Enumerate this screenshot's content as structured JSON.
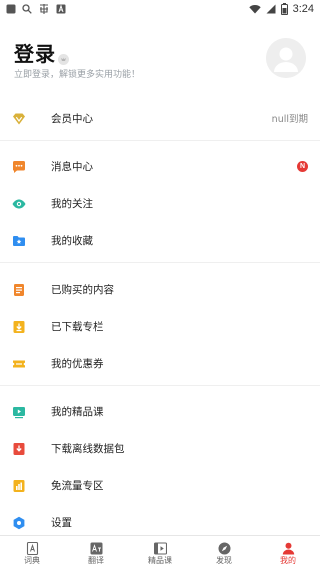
{
  "status_bar": {
    "time": "3:24",
    "left_icons": [
      "app-square-icon",
      "search-icon",
      "chinese-char-icon",
      "font-a-icon"
    ],
    "right_icons": [
      "wifi-icon",
      "signal-icon",
      "battery-icon"
    ]
  },
  "header": {
    "title": "登录",
    "subtitle": "立即登录，解锁更多实用功能！"
  },
  "menu": {
    "vip": {
      "label": "会员中心",
      "right_text": "null到期",
      "icon": "diamond-icon",
      "color": "#d9b13a"
    },
    "messages": {
      "label": "消息中心",
      "badge": "N",
      "icon": "chat-bubble-icon",
      "color": "#f0862c"
    },
    "follow": {
      "label": "我的关注",
      "icon": "eye-icon",
      "color": "#2bb8a1"
    },
    "favorites": {
      "label": "我的收藏",
      "icon": "folder-star-icon",
      "color": "#2f8ef0"
    },
    "purchased": {
      "label": "已购买的内容",
      "icon": "receipt-icon",
      "color": "#f0862c"
    },
    "downloaded": {
      "label": "已下载专栏",
      "icon": "download-icon",
      "color": "#f3b21d"
    },
    "coupons": {
      "label": "我的优惠券",
      "icon": "ticket-icon",
      "color": "#f3b21d"
    },
    "courses": {
      "label": "我的精品课",
      "icon": "video-play-icon",
      "color": "#2bb8a1"
    },
    "offline": {
      "label": "下载离线数据包",
      "icon": "offline-download-icon",
      "color": "#e84b3c"
    },
    "free_traffic": {
      "label": "免流量专区",
      "icon": "data-bars-icon",
      "color": "#f3b21d"
    },
    "settings": {
      "label": "设置",
      "icon": "gear-icon",
      "color": "#2f8ef0"
    }
  },
  "bottom_nav": {
    "dictionary": "词典",
    "translate": "翻译",
    "courses": "精品课",
    "discover": "发现",
    "mine": "我的",
    "active": "mine",
    "active_color": "#e53935"
  }
}
